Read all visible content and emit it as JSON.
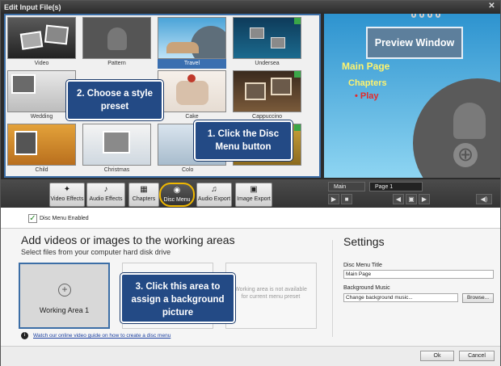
{
  "window": {
    "title": "Edit Input File(s)"
  },
  "presets": [
    {
      "name": "Video"
    },
    {
      "name": "Pattern"
    },
    {
      "name": "Travel",
      "selected": true
    },
    {
      "name": "Undersea"
    },
    {
      "name": "Wedding"
    },
    {
      "name": ""
    },
    {
      "name": "Cake"
    },
    {
      "name": "Cappuccino"
    },
    {
      "name": "Child"
    },
    {
      "name": "Christmas"
    },
    {
      "name": "Colo"
    },
    {
      "name": ""
    }
  ],
  "callouts": {
    "style_preset": "2. Choose a style preset",
    "disc_menu": "1. Click the Disc Menu button",
    "working_area": "3. Click this area to assign a background picture"
  },
  "preview": {
    "label": "Preview Window",
    "menu_items": [
      "Main Page",
      "Chapters",
      "• Play"
    ]
  },
  "toolbar": [
    {
      "label": "Video Effects",
      "icon": "video-effects-icon"
    },
    {
      "label": "Audio Effects",
      "icon": "audio-effects-icon"
    },
    {
      "label": "Chapters",
      "icon": "chapters-icon"
    },
    {
      "label": "Disc Menu",
      "icon": "disc-menu-icon",
      "active": true
    },
    {
      "label": "Audio Export",
      "icon": "audio-export-icon"
    },
    {
      "label": "Image Export",
      "icon": "image-export-icon"
    }
  ],
  "tabs": {
    "main": "Main",
    "page": "Page 1"
  },
  "disc_menu_enabled": {
    "label": "Disc Menu Enabled",
    "checked": true
  },
  "main": {
    "heading": "Add videos or images to the working areas",
    "subheading": "Select files from your computer hard disk drive",
    "working_area_1": "Working Area 1",
    "working_area_3_text": "Working area is not available for current menu preset",
    "help_link": "Watch our online video guide on how to create a disc menu"
  },
  "settings": {
    "heading": "Settings",
    "title_label": "Disc Menu Title",
    "title_value": "Main Page",
    "music_label": "Background Music",
    "music_value": "Change background music...",
    "browse_label": "Browse..."
  },
  "footer": {
    "ok": "Ok",
    "cancel": "Cancel"
  },
  "colors": {
    "accent": "#234a85",
    "highlight": "#f0b800",
    "selection": "#3a6fb0"
  }
}
